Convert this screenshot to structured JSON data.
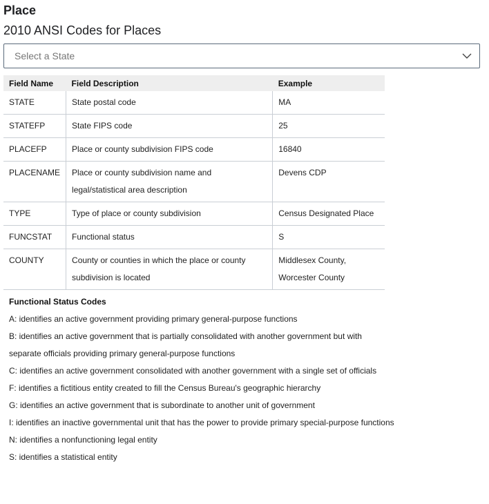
{
  "page": {
    "heading": "Place",
    "subheading": "2010 ANSI Codes for Places"
  },
  "state_select": {
    "placeholder": "Select a State",
    "icon": "chevron-down-icon"
  },
  "table": {
    "headers": [
      "Field Name",
      "Field Description",
      "Example"
    ],
    "rows": [
      {
        "field": "STATE",
        "description": "State postal code",
        "example": "MA"
      },
      {
        "field": "STATEFP",
        "description": "State FIPS code",
        "example": "25"
      },
      {
        "field": "PLACEFP",
        "description": "Place or county subdivision FIPS code",
        "example": "16840"
      },
      {
        "field": "PLACENAME",
        "description": "Place or county subdivision name and legal/statistical area description",
        "example": "Devens CDP"
      },
      {
        "field": "TYPE",
        "description": "Type of place or county subdivision",
        "example": "Census Designated Place"
      },
      {
        "field": "FUNCSTAT",
        "description": "Functional status",
        "example": "S"
      },
      {
        "field": "COUNTY",
        "description": "County or counties in which the place or county subdivision is located",
        "example": "Middlesex County, Worcester County"
      }
    ]
  },
  "functional_status": {
    "title": "Functional Status Codes",
    "codes": [
      "A:  identifies an active government providing primary general-purpose functions",
      "B:  identifies an active government that is partially consolidated with another government but with separate officials providing primary general-purpose functions",
      "C:  identifies an active government consolidated with another government with a single set of officials",
      "F:  identifies a fictitious entity created to fill the Census Bureau's geographic hierarchy",
      "G:  identifies an active government that is subordinate to another unit of government",
      "I:  identifies an inactive governmental unit that has the power to provide primary special-purpose functions",
      "N:  identifies a nonfunctioning legal entity",
      "S:  identifies a statistical entity"
    ]
  }
}
